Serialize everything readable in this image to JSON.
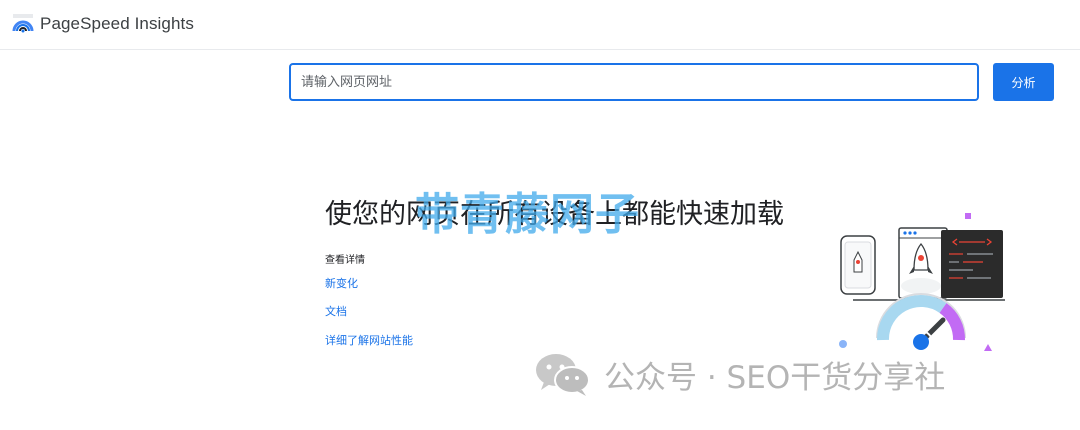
{
  "header": {
    "brand_name": "PageSpeed Insights",
    "logo_icon": "pagespeed-gauge-icon"
  },
  "search": {
    "placeholder": "请输入网页网址",
    "value": "",
    "analyze_label": "分析"
  },
  "main": {
    "headline": "使您的网页在所有设备上都能快速加载",
    "details_label": "查看详情",
    "links": [
      "新变化",
      "文档",
      "详细了解网站性能"
    ]
  },
  "watermarks": {
    "overlay_text": "带青藤网子",
    "footer_text": "公众号 · SEO干货分享社",
    "footer_icon": "wechat-icon"
  },
  "illustration": {
    "icons": [
      "phone-icon",
      "rocket-icon",
      "browser-window-icon",
      "code-panel-icon",
      "speed-gauge-icon"
    ]
  },
  "colors": {
    "accent": "#1a73e8",
    "text": "#202124",
    "watermark_blue": "#40aaeb",
    "watermark_gray": "#b4b4b4",
    "gauge_purple": "#c26bf4"
  }
}
